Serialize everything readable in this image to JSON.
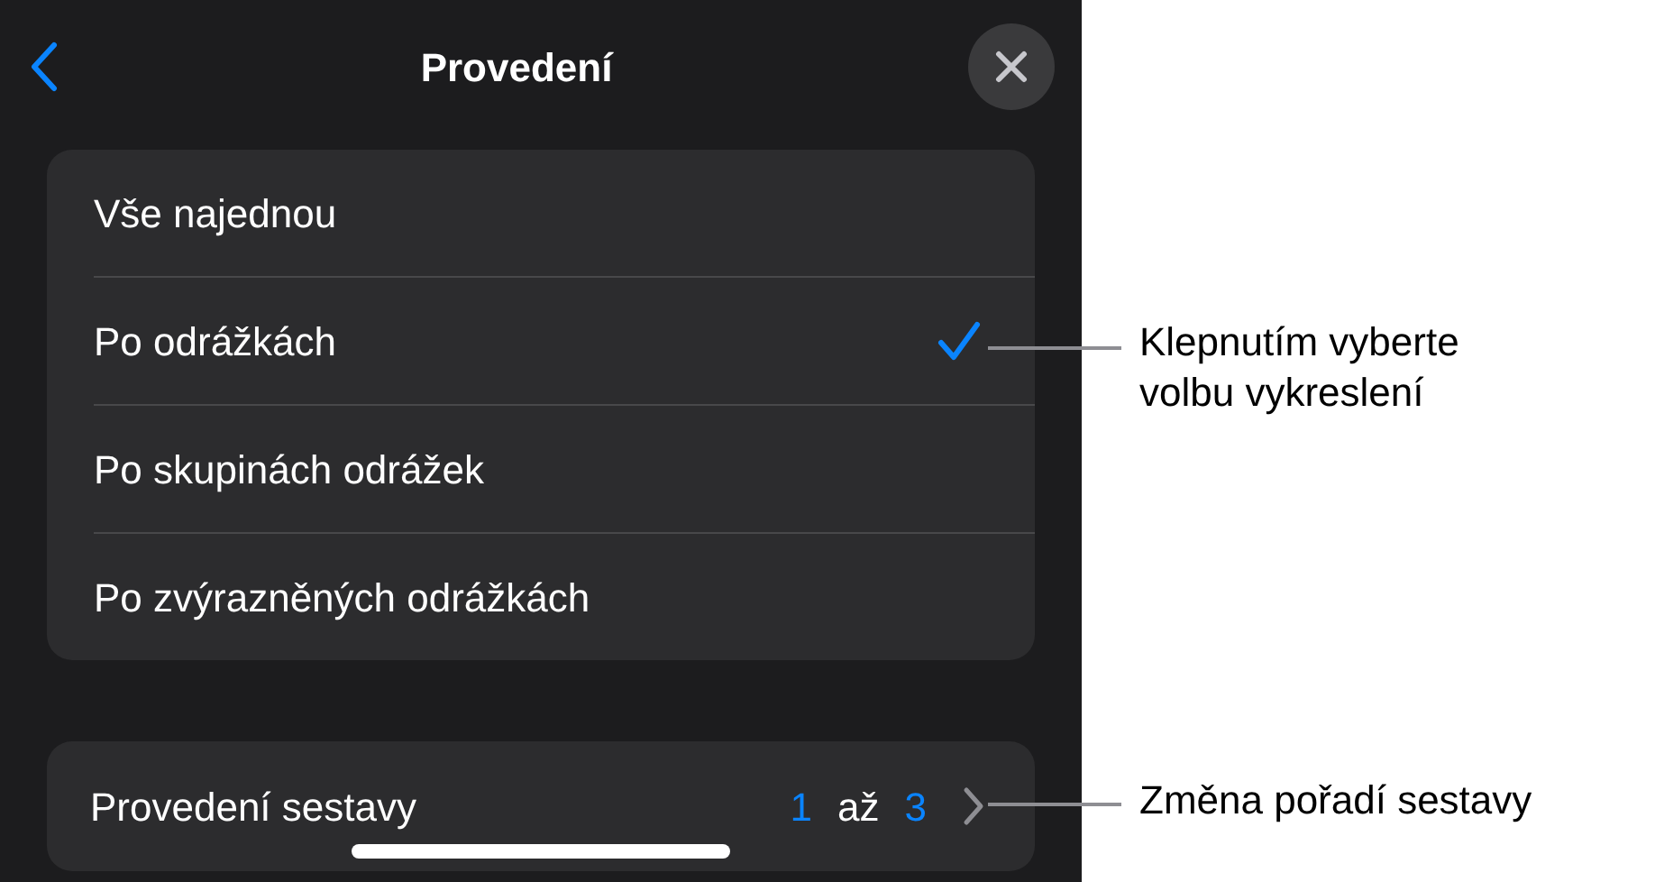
{
  "header": {
    "title": "Provedení"
  },
  "options": [
    {
      "label": "Vše najednou",
      "selected": false
    },
    {
      "label": "Po odrážkách",
      "selected": true
    },
    {
      "label": "Po skupinách odrážek",
      "selected": false
    },
    {
      "label": "Po zvýrazněných odrážkách",
      "selected": false
    }
  ],
  "sequence": {
    "label": "Provedení sestavy",
    "from": "1",
    "separator": "až",
    "to": "3"
  },
  "callouts": [
    {
      "text": "Klepnutím vyberte volbu vykreslení"
    },
    {
      "text": "Změna pořadí sestavy"
    }
  ]
}
